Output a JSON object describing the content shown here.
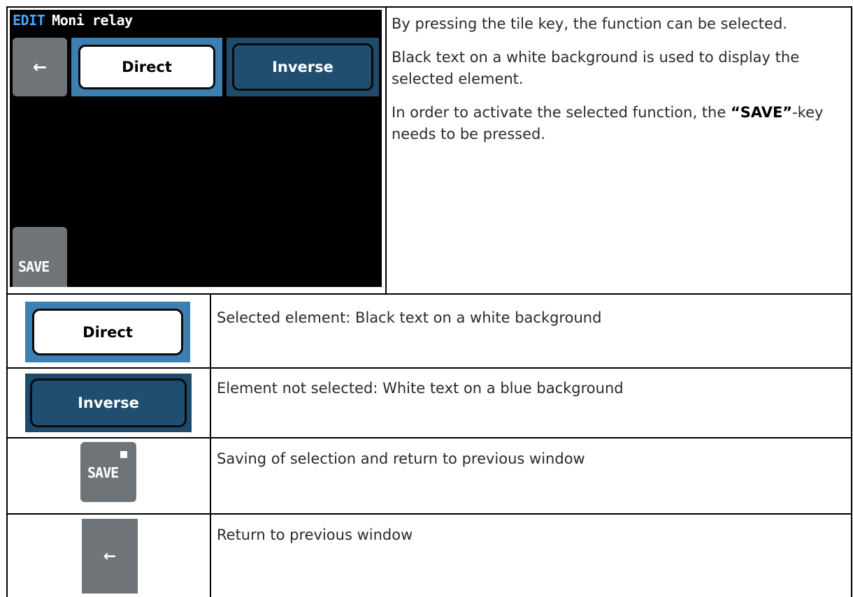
{
  "screen": {
    "mode_label": "EDIT",
    "title": "Moni relay",
    "back_icon": "←",
    "option_selected": "Direct",
    "option_unselected": "Inverse",
    "save_label": "SAVE"
  },
  "description": {
    "p1": "By pressing the tile key, the function can be selected.",
    "p2": "Black text on a white background is used to display the selected element.",
    "p3_pre": "In order to activate the selected function, the ",
    "p3_key": "“SAVE”",
    "p3_post": "-key needs to be pressed."
  },
  "legend": [
    {
      "icon_label": "Direct",
      "text": "Selected element: Black text on a white background"
    },
    {
      "icon_label": "Inverse",
      "text": "Element not selected: White text on a blue background"
    },
    {
      "icon_label": "SAVE",
      "text": "Saving of selection and return to previous window"
    },
    {
      "icon_label": "←",
      "text": "Return to previous window"
    }
  ],
  "colors": {
    "selected_frame": "#3c7fb1",
    "unselected_tile": "#1f4e6e",
    "grey_tile": "#6e7478",
    "mode_label": "#4aa3ff"
  }
}
